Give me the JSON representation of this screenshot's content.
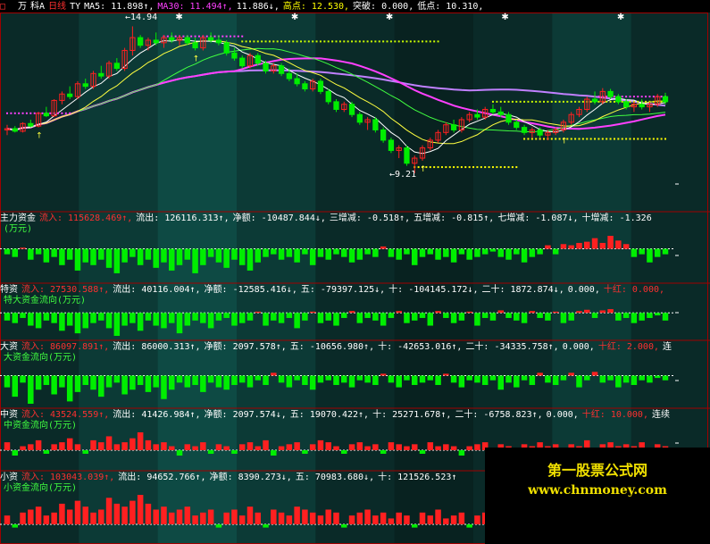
{
  "colors": {
    "up": "#ff2020",
    "down": "#00ee00",
    "ma5": "#ffffff",
    "ma10": "#ffff40",
    "ma20": "#40ff40",
    "ma30": "#ff40ff",
    "ma60": "#c080ff",
    "label": "#ffffff",
    "warn": "#ffff00",
    "sep": "#a00000",
    "axis": "#ffffff"
  },
  "top_bar": {
    "logo_glyph": "□",
    "items": [
      {
        "text": "万",
        "color": "#ffffff"
      },
      {
        "text": "科A",
        "color": "#ffffff"
      },
      {
        "text": "日线",
        "color": "#ff3030"
      },
      {
        "text": "TY",
        "color": "#ffffff"
      },
      {
        "text": "MA5: 11.898↑,",
        "color": "#ffffff"
      },
      {
        "text": "MA30: 11.494↑,",
        "color": "#ff40ff"
      },
      {
        "text": "11.886↓,",
        "color": "#ffffff"
      },
      {
        "text": "高点: 12.530,",
        "color": "#ffff00"
      },
      {
        "text": "突破: 0.000,",
        "color": "#ffffff"
      },
      {
        "text": "低点: 10.310,",
        "color": "#ffffff"
      }
    ]
  },
  "price_panel": {
    "high_label": "←14.94",
    "low_label": "←9.21"
  },
  "panels": [
    {
      "id": "main",
      "title": "主力资金",
      "unit": "(万元)",
      "items": [
        {
          "text": "流入: 115628.469↑,",
          "color": "#ff3030"
        },
        {
          "text": "流出: 126116.313↑,",
          "color": "#ffffff"
        },
        {
          "text": "净额: -10487.844↓,",
          "color": "#ffffff"
        },
        {
          "text": "三增减: -0.518↑,",
          "color": "#ffffff"
        },
        {
          "text": "五增减: -0.815↑,",
          "color": "#ffffff"
        },
        {
          "text": "七增减: -1.087↓,",
          "color": "#ffffff"
        },
        {
          "text": "十增减: -1.326",
          "color": "#ffffff"
        }
      ]
    },
    {
      "id": "xl",
      "title": "特资",
      "unit": "特大资金流向(万元)",
      "items": [
        {
          "text": "流入: 27530.588↑,",
          "color": "#ff3030"
        },
        {
          "text": "流出: 40116.004↑,",
          "color": "#ffffff"
        },
        {
          "text": "净额: -12585.416↓,",
          "color": "#ffffff"
        },
        {
          "text": "五: -79397.125↓,",
          "color": "#ffffff"
        },
        {
          "text": "十: -104145.172↓,",
          "color": "#ffffff"
        },
        {
          "text": "二十: 1872.874↓,",
          "color": "#ffffff"
        },
        {
          "text": "0.000,",
          "color": "#ffffff"
        },
        {
          "text": "十红: 0.000,",
          "color": "#ff3030"
        }
      ]
    },
    {
      "id": "lg",
      "title": "大资",
      "unit": "大资金流向(万元)",
      "items": [
        {
          "text": "流入: 86097.891↑,",
          "color": "#ff3030"
        },
        {
          "text": "流出: 86000.313↑,",
          "color": "#ffffff"
        },
        {
          "text": "净额: 2097.578↑,",
          "color": "#ffffff"
        },
        {
          "text": "五: -10656.980↑,",
          "color": "#ffffff"
        },
        {
          "text": "十: -42653.016↑,",
          "color": "#ffffff"
        },
        {
          "text": "二十: -34335.758↑,",
          "color": "#ffffff"
        },
        {
          "text": "0.000,",
          "color": "#ffffff"
        },
        {
          "text": "十红: 2.000,",
          "color": "#ff3030"
        },
        {
          "text": "连",
          "color": "#ffffff"
        }
      ]
    },
    {
      "id": "md",
      "title": "中资",
      "unit": "中资金流向(万元)",
      "items": [
        {
          "text": "流入: 43524.559↑,",
          "color": "#ff3030"
        },
        {
          "text": "流出: 41426.984↑,",
          "color": "#ffffff"
        },
        {
          "text": "净额: 2097.574↓,",
          "color": "#ffffff"
        },
        {
          "text": "五: 19070.422↑,",
          "color": "#ffffff"
        },
        {
          "text": "十: 25271.678↑,",
          "color": "#ffffff"
        },
        {
          "text": "二十: -6758.823↑,",
          "color": "#ffffff"
        },
        {
          "text": "0.000,",
          "color": "#ffffff"
        },
        {
          "text": "十红: 10.000,",
          "color": "#ff3030"
        },
        {
          "text": "连续",
          "color": "#ffffff"
        }
      ]
    },
    {
      "id": "sm",
      "title": "小资",
      "unit": "小资金流向(万元)",
      "items": [
        {
          "text": "流入: 103043.039↑,",
          "color": "#ff3030"
        },
        {
          "text": "流出: 94652.766↑,",
          "color": "#ffffff"
        },
        {
          "text": "净额: 8390.273↓,",
          "color": "#ffffff"
        },
        {
          "text": "五: 70983.680↓,",
          "color": "#ffffff"
        },
        {
          "text": "十: 121526.523↑",
          "color": "#ffffff"
        }
      ]
    }
  ],
  "watermark": {
    "title": "第一股票公式网",
    "url": "www.chnmoney.com"
  },
  "chart_data": {
    "type": "candlestick",
    "title": "",
    "ylim": [
      9.0,
      15.2
    ],
    "ohlc": [
      [
        10.9,
        11.1,
        10.7,
        10.95
      ],
      [
        10.95,
        11.05,
        10.8,
        10.85
      ],
      [
        10.85,
        11.2,
        10.8,
        11.15
      ],
      [
        11.15,
        11.3,
        11.0,
        11.05
      ],
      [
        11.05,
        11.6,
        11.0,
        11.55
      ],
      [
        11.55,
        11.8,
        11.4,
        11.45
      ],
      [
        11.45,
        12.1,
        11.4,
        12.05
      ],
      [
        12.05,
        12.4,
        11.9,
        12.3
      ],
      [
        12.3,
        12.6,
        12.1,
        12.2
      ],
      [
        12.2,
        12.8,
        12.1,
        12.7
      ],
      [
        12.7,
        12.9,
        12.5,
        12.6
      ],
      [
        12.6,
        13.2,
        12.5,
        13.1
      ],
      [
        13.1,
        13.4,
        12.9,
        13.0
      ],
      [
        13.0,
        13.6,
        12.9,
        13.5
      ],
      [
        13.5,
        13.7,
        13.2,
        13.3
      ],
      [
        13.3,
        14.1,
        13.2,
        14.0
      ],
      [
        14.0,
        14.94,
        13.8,
        14.5
      ],
      [
        14.5,
        14.6,
        14.1,
        14.2
      ],
      [
        14.2,
        14.5,
        14.0,
        14.4
      ],
      [
        14.4,
        14.7,
        14.2,
        14.3
      ],
      [
        14.3,
        14.6,
        14.1,
        14.5
      ],
      [
        14.5,
        14.7,
        14.3,
        14.4
      ],
      [
        14.4,
        14.6,
        14.2,
        14.5
      ],
      [
        14.5,
        14.6,
        14.2,
        14.3
      ],
      [
        14.3,
        14.5,
        14.0,
        14.1
      ],
      [
        14.1,
        14.6,
        14.0,
        14.5
      ],
      [
        14.5,
        14.7,
        14.3,
        14.4
      ],
      [
        14.4,
        14.6,
        14.2,
        14.3
      ],
      [
        14.3,
        14.4,
        13.8,
        13.9
      ],
      [
        13.9,
        14.1,
        13.6,
        13.7
      ],
      [
        13.7,
        13.8,
        13.3,
        13.4
      ],
      [
        13.4,
        13.9,
        13.3,
        13.8
      ],
      [
        13.8,
        13.9,
        13.4,
        13.5
      ],
      [
        13.5,
        13.6,
        13.1,
        13.2
      ],
      [
        13.2,
        13.5,
        13.1,
        13.4
      ],
      [
        13.4,
        13.5,
        13.0,
        13.1
      ],
      [
        13.1,
        13.3,
        12.8,
        12.9
      ],
      [
        12.9,
        13.1,
        12.6,
        12.7
      ],
      [
        12.7,
        12.8,
        12.4,
        12.5
      ],
      [
        12.5,
        12.9,
        12.4,
        12.8
      ],
      [
        12.8,
        12.9,
        12.3,
        12.4
      ],
      [
        12.4,
        12.5,
        11.9,
        12.0
      ],
      [
        12.0,
        12.1,
        11.6,
        11.7
      ],
      [
        11.7,
        12.0,
        11.6,
        11.9
      ],
      [
        11.9,
        12.0,
        11.4,
        11.5
      ],
      [
        11.5,
        11.6,
        11.1,
        11.2
      ],
      [
        11.2,
        11.4,
        10.9,
        11.3
      ],
      [
        11.3,
        11.4,
        10.8,
        10.9
      ],
      [
        10.9,
        11.0,
        10.4,
        10.5
      ],
      [
        10.5,
        10.6,
        10.0,
        10.1
      ],
      [
        10.1,
        10.3,
        9.8,
        10.2
      ],
      [
        10.2,
        10.3,
        9.5,
        9.6
      ],
      [
        9.6,
        9.9,
        9.21,
        9.8
      ],
      [
        9.8,
        10.3,
        9.7,
        10.2
      ],
      [
        10.2,
        10.6,
        10.1,
        10.5
      ],
      [
        10.5,
        10.9,
        10.4,
        10.8
      ],
      [
        10.8,
        11.2,
        10.7,
        11.1
      ],
      [
        11.1,
        11.3,
        10.8,
        10.9
      ],
      [
        10.9,
        11.4,
        10.8,
        11.3
      ],
      [
        11.3,
        11.6,
        11.2,
        11.5
      ],
      [
        11.5,
        11.7,
        11.3,
        11.4
      ],
      [
        11.4,
        11.8,
        11.3,
        11.7
      ],
      [
        11.7,
        11.9,
        11.5,
        11.6
      ],
      [
        11.6,
        11.8,
        11.4,
        11.5
      ],
      [
        11.5,
        11.6,
        11.1,
        11.2
      ],
      [
        11.2,
        11.3,
        10.9,
        11.0
      ],
      [
        11.0,
        11.1,
        10.7,
        10.8
      ],
      [
        10.8,
        11.0,
        10.6,
        10.9
      ],
      [
        10.9,
        11.0,
        10.6,
        10.7
      ],
      [
        10.7,
        10.9,
        10.5,
        10.8
      ],
      [
        10.8,
        11.0,
        10.7,
        10.9
      ],
      [
        10.9,
        11.3,
        10.8,
        11.2
      ],
      [
        11.2,
        11.6,
        11.1,
        11.5
      ],
      [
        11.5,
        11.8,
        11.4,
        11.7
      ],
      [
        11.7,
        12.2,
        11.6,
        12.1
      ],
      [
        12.1,
        12.4,
        11.9,
        12.0
      ],
      [
        12.0,
        12.53,
        11.9,
        12.4
      ],
      [
        12.4,
        12.5,
        12.1,
        12.2
      ],
      [
        12.2,
        12.3,
        11.9,
        12.0
      ],
      [
        12.0,
        12.1,
        11.7,
        11.8
      ],
      [
        11.8,
        12.0,
        11.6,
        11.9
      ],
      [
        11.9,
        12.1,
        11.7,
        11.8
      ],
      [
        11.8,
        12.0,
        11.6,
        11.9
      ],
      [
        11.9,
        12.3,
        11.8,
        12.2
      ],
      [
        12.2,
        12.35,
        11.9,
        12.0
      ]
    ],
    "ma5_value": 11.898,
    "ma30_value": 11.494,
    "high": 12.53,
    "low": 10.31,
    "flow_series": {
      "main": [
        -2,
        -3,
        1,
        -4,
        -2,
        -5,
        -3,
        -6,
        -4,
        -8,
        -5,
        -6,
        -4,
        -7,
        -9,
        -5,
        -3,
        -6,
        -4,
        -7,
        -5,
        -8,
        -6,
        -4,
        -9,
        -6,
        -3,
        -5,
        -7,
        -4,
        -6,
        -8,
        -5,
        -3,
        -2,
        -4,
        -3,
        -5,
        -2,
        -6,
        -3,
        -4,
        -2,
        -3,
        -5,
        -4,
        -2,
        -3,
        2,
        -3,
        -4,
        -2,
        -6,
        -3,
        -2,
        -4,
        -3,
        -5,
        -2,
        -4,
        -3,
        -2,
        -1,
        -3,
        -4,
        -2,
        -5,
        -3,
        -2,
        3,
        -2,
        4,
        3,
        5,
        6,
        9,
        5,
        11,
        7,
        4,
        -3,
        -2,
        -5,
        -3,
        -2
      ],
      "xl": [
        -3,
        -4,
        -2,
        -5,
        -6,
        -3,
        -4,
        -7,
        -5,
        -8,
        -6,
        -4,
        -3,
        -6,
        -9,
        -5,
        -4,
        -7,
        -3,
        -5,
        -6,
        -4,
        -8,
        -5,
        -3,
        -4,
        -6,
        -3,
        -2,
        -5,
        -4,
        -3,
        2,
        -5,
        -3,
        -4,
        -2,
        -6,
        -3,
        2,
        -4,
        -3,
        -5,
        -2,
        3,
        -4,
        -2,
        -3,
        -5,
        -2,
        3,
        -4,
        -3,
        -2,
        -5,
        3,
        -2,
        -4,
        -3,
        2,
        -5,
        -2,
        -3,
        4,
        -2,
        -3,
        -4,
        3,
        -2,
        -3,
        2,
        -4,
        -3,
        3,
        5,
        -2,
        4,
        6,
        -3,
        -2,
        -4,
        -3,
        -2,
        -1,
        -3
      ],
      "lg": [
        -5,
        -9,
        -3,
        -12,
        -6,
        -4,
        -8,
        -5,
        -11,
        -7,
        -4,
        -6,
        -9,
        -5,
        -3,
        -8,
        -6,
        -4,
        -7,
        -5,
        -10,
        -6,
        -3,
        -5,
        -4,
        -7,
        -3,
        -5,
        -6,
        -4,
        -3,
        -5,
        -2,
        -4,
        3,
        -3,
        -5,
        -2,
        -4,
        -6,
        -3,
        -2,
        -4,
        -3,
        -5,
        -2,
        -3,
        -4,
        2,
        -3,
        -5,
        -2,
        -4,
        -3,
        -2,
        -4,
        2,
        -3,
        -5,
        -2,
        -3,
        -4,
        -2,
        -6,
        -3,
        -5,
        -2,
        -4,
        3,
        -3,
        -4,
        -2,
        3,
        -5,
        -2,
        4,
        -3,
        -2,
        -5,
        -3,
        -4,
        -2,
        -3,
        -1,
        -2
      ],
      "md": [
        4,
        -3,
        2,
        3,
        5,
        -2,
        3,
        4,
        6,
        3,
        -2,
        5,
        4,
        7,
        3,
        4,
        6,
        9,
        5,
        3,
        4,
        2,
        -3,
        3,
        2,
        4,
        -2,
        3,
        2,
        -2,
        3,
        4,
        2,
        5,
        -3,
        2,
        3,
        4,
        -2,
        3,
        5,
        4,
        2,
        -2,
        3,
        4,
        2,
        3,
        -2,
        4,
        3,
        2,
        3,
        -2,
        4,
        2,
        3,
        2,
        -3,
        2,
        3,
        4,
        -2,
        3,
        2,
        -2,
        3,
        2,
        4,
        2,
        3,
        -2,
        3,
        2,
        5,
        -2,
        3,
        4,
        2,
        3,
        2,
        4,
        -2,
        3,
        2
      ],
      "sm": [
        3,
        -2,
        4,
        5,
        6,
        3,
        4,
        7,
        5,
        8,
        6,
        4,
        5,
        9,
        7,
        6,
        8,
        10,
        7,
        5,
        6,
        4,
        5,
        6,
        3,
        4,
        5,
        -2,
        4,
        5,
        3,
        6,
        4,
        -2,
        5,
        4,
        3,
        6,
        5,
        4,
        3,
        5,
        4,
        -2,
        3,
        4,
        5,
        3,
        4,
        2,
        4,
        3,
        -2,
        4,
        3,
        5,
        2,
        3,
        4,
        -2,
        3,
        4,
        2,
        3,
        4,
        3,
        2,
        4,
        -2,
        3,
        2,
        3,
        4,
        2,
        3,
        -2,
        3,
        2,
        4,
        3,
        2,
        3,
        -2,
        3,
        2
      ]
    }
  }
}
